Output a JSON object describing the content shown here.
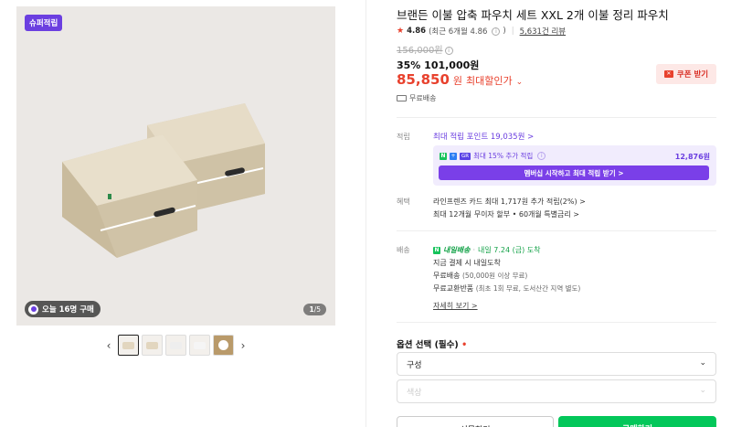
{
  "gallery": {
    "super_badge": "슈퍼적립",
    "today_badge": "오늘 16명 구매",
    "page_current": "1",
    "page_total": "/5",
    "prev_arrow": "‹",
    "next_arrow": "›"
  },
  "product": {
    "title": "브랜든 이불 압축 파우치 세트 XXL 2개 이불 정리 파우치",
    "rating": "4.86",
    "rating_note": "(최근 6개월 4.86",
    "rating_note_end": ")",
    "reviews": "5,631건 리뷰",
    "original_price": "156,000원",
    "discount_line": "35% 101,000원",
    "best_price": "85,850",
    "best_won": "원",
    "best_label": "최대할인가",
    "coupon_label": "쿠폰 받기",
    "shipping": "무료배송"
  },
  "points": {
    "section_label": "적립",
    "link": "최대 적립 포인트 19,035원 >",
    "extra": "최대 15% 추가 적립",
    "amount": "12,876원",
    "cta": "멤버십 시작하고 최대 적립 받기 >"
  },
  "benefits": {
    "section_label": "혜택",
    "line1": "라인프렌즈 카드 최대 1,717원 추가 적립(2%) >",
    "line2": "최대 12개월 무이자 할부 • 60개월 특별금리 >"
  },
  "delivery": {
    "section_label": "배송",
    "tomorrow": "내일배송",
    "sep": "·",
    "arrival": "내일 7.24 (금) 도착",
    "line1": "지금 결제 시 내일도착",
    "line2_main": "무료배송",
    "line2_sub": "(50,000원 이상 무료)",
    "line3_main": "무료교환반품",
    "line3_sub": "(최초 1회 무료, 도서산간 지역 별도)",
    "more": "자세히 보기 >"
  },
  "options": {
    "title": "옵션 선택 (필수)",
    "required_mark": "•",
    "select1": "구성",
    "select2": "색상"
  },
  "buttons": {
    "gift": "선물하기",
    "buy": "구매하기"
  },
  "colors": {
    "accent_purple": "#6b3fe0",
    "sale_red": "#e8412d",
    "naver_green": "#03c75a"
  }
}
